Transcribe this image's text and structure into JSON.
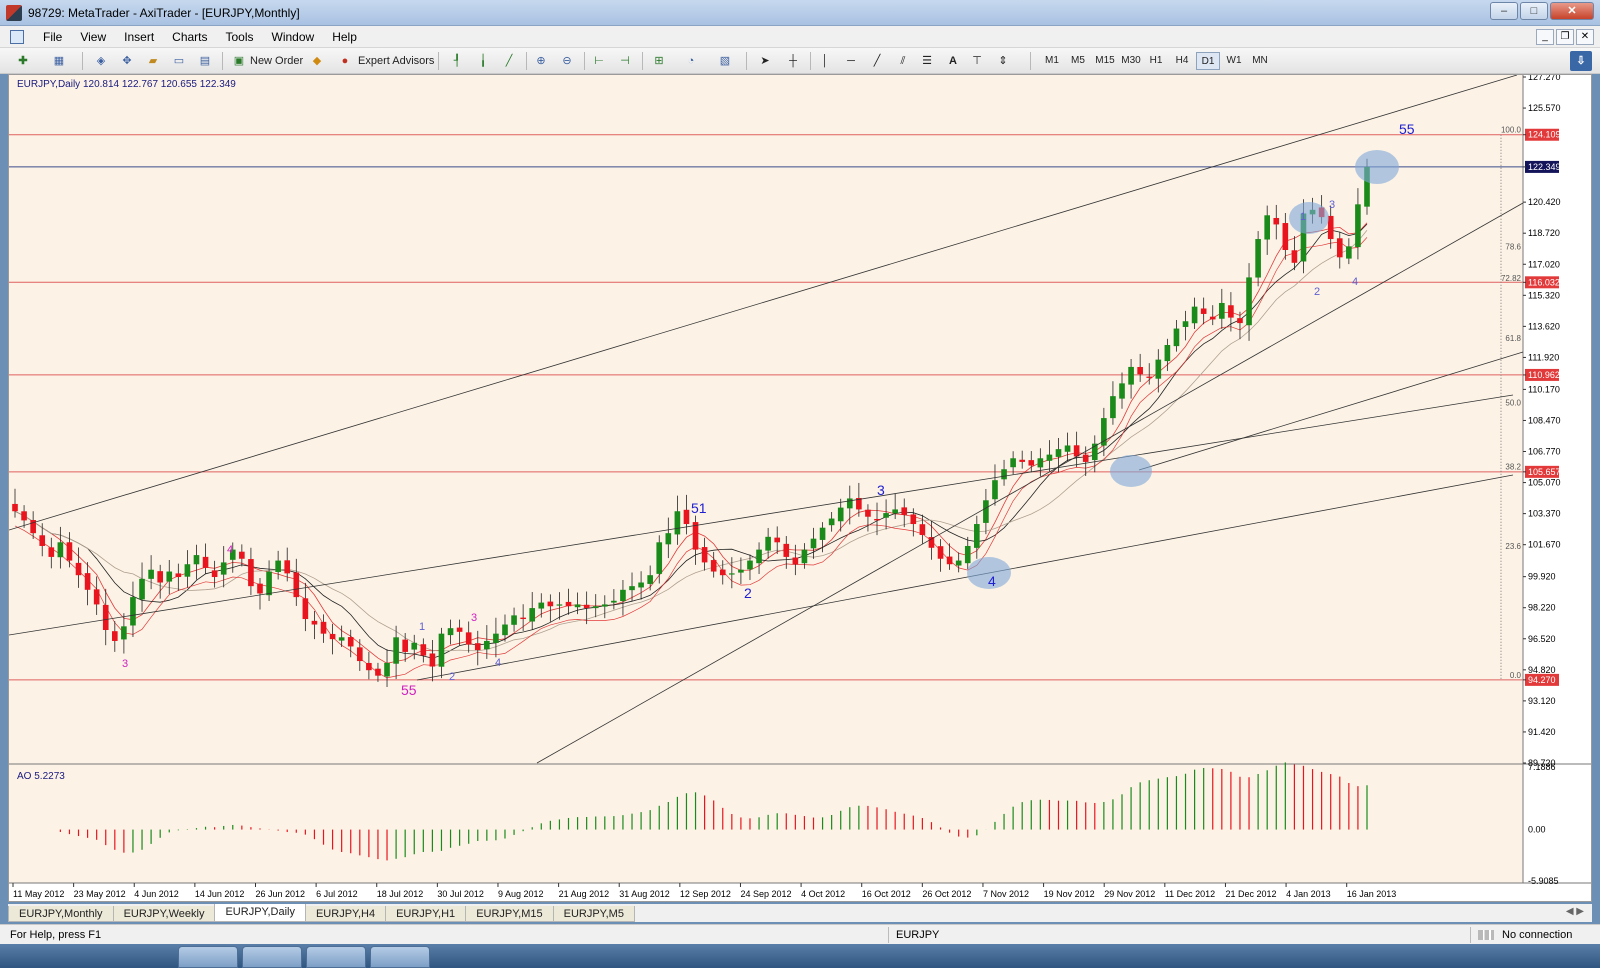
{
  "window": {
    "title": "98729: MetaTrader - AxiTrader - [EURJPY,Monthly]",
    "minimize": "–",
    "maximize": "□",
    "close": "✕"
  },
  "menu": [
    "File",
    "View",
    "Insert",
    "Charts",
    "Tools",
    "Window",
    "Help"
  ],
  "mdi": {
    "minimize": "_",
    "restore": "❐",
    "close": "✕"
  },
  "toolbar": {
    "new_order": "New Order",
    "expert_advisors": "Expert Advisors",
    "text_tool": "A",
    "timeframes": [
      "M1",
      "M5",
      "M15",
      "M30",
      "H1",
      "H4",
      "D1",
      "W1",
      "MN"
    ],
    "active_timeframe": "D1"
  },
  "chart": {
    "symbol_info": "EURJPY,Daily  120.814 122.767 120.655 122.349",
    "price_ticks": [
      "127.270",
      "125.570",
      "124.109",
      "122.349",
      "120.420",
      "118.720",
      "117.020",
      "116.032",
      "115.320",
      "113.620",
      "111.920",
      "110.962",
      "110.170",
      "108.470",
      "106.770",
      "105.657",
      "105.070",
      "103.370",
      "101.670",
      "99.920",
      "98.220",
      "96.520",
      "94.820",
      "94.270",
      "93.120",
      "91.420",
      "89.720"
    ],
    "highlighted_prices": {
      "current": "122.349",
      "red_levels": [
        "124.109",
        "116.032",
        "110.962",
        "105.657",
        "94.270"
      ]
    },
    "fib_labels": [
      "100.0",
      "78.6",
      "72.82",
      "61.8",
      "50.0",
      "38.2",
      "23.6",
      "0.0"
    ],
    "wave_labels": [
      "3",
      "4",
      "55",
      "1",
      "2",
      "3",
      "4",
      "51",
      "2",
      "3",
      "4",
      "1",
      "2",
      "3",
      "4",
      "55"
    ],
    "date_ticks": [
      "11 May 2012",
      "23 May 2012",
      "4 Jun 2012",
      "14 Jun 2012",
      "26 Jun 2012",
      "6 Jul 2012",
      "18 Jul 2012",
      "30 Jul 2012",
      "9 Aug 2012",
      "21 Aug 2012",
      "31 Aug 2012",
      "12 Sep 2012",
      "24 Sep 2012",
      "4 Oct 2012",
      "16 Oct 2012",
      "26 Oct 2012",
      "7 Nov 2012",
      "19 Nov 2012",
      "29 Nov 2012",
      "11 Dec 2012",
      "21 Dec 2012",
      "4 Jan 2013",
      "16 Jan 2013"
    ],
    "ao_label": "AO 5.2273",
    "ao_ticks": [
      "7.1886",
      "0.00",
      "-5.9085"
    ]
  },
  "chart_data": {
    "type": "line",
    "title": "",
    "price": {
      "open": 120.814,
      "high": 122.767,
      "low": 120.655,
      "close": 122.349
    },
    "ylim": [
      89.72,
      127.27
    ],
    "close_series": [
      103.5,
      103.0,
      102.3,
      101.6,
      101.0,
      101.8,
      100.8,
      100.0,
      99.2,
      98.4,
      97.0,
      96.4,
      97.2,
      98.8,
      99.8,
      100.3,
      99.6,
      100.2,
      99.9,
      100.6,
      101.1,
      100.4,
      99.9,
      100.7,
      101.4,
      100.9,
      99.4,
      99.0,
      100.2,
      100.8,
      100.1,
      98.8,
      97.6,
      97.3,
      96.8,
      96.5,
      96.6,
      96.1,
      95.3,
      94.8,
      94.5,
      95.2,
      96.6,
      95.8,
      96.3,
      95.6,
      95.0,
      96.8,
      97.1,
      96.9,
      96.2,
      95.9,
      96.4,
      96.8,
      97.3,
      97.8,
      97.6,
      98.2,
      98.5,
      98.3,
      98.4,
      98.3,
      98.4,
      98.2,
      98.3,
      98.4,
      98.6,
      99.2,
      99.4,
      99.6,
      100.0,
      101.8,
      102.3,
      103.5,
      102.8,
      101.4,
      100.7,
      100.2,
      100.0,
      100.1,
      100.3,
      100.8,
      101.4,
      102.1,
      101.8,
      101.0,
      100.6,
      101.4,
      102.0,
      102.6,
      103.1,
      103.7,
      104.2,
      103.6,
      103.2,
      103.0,
      103.4,
      103.6,
      103.3,
      102.8,
      102.2,
      101.5,
      100.9,
      100.6,
      100.8,
      101.6,
      102.8,
      104.1,
      105.2,
      105.8,
      106.4,
      106.2,
      106.0,
      106.4,
      106.6,
      106.9,
      107.1,
      106.5,
      106.2,
      107.2,
      108.6,
      109.8,
      110.5,
      111.4,
      111.0,
      110.8,
      111.8,
      112.6,
      113.5,
      113.9,
      114.7,
      114.3,
      114.0,
      114.9,
      114.1,
      113.8,
      116.3,
      118.4,
      119.7,
      119.2,
      117.8,
      117.1,
      119.8,
      120.0,
      119.6,
      118.4,
      117.4,
      118.0,
      120.3,
      122.349
    ],
    "x": [
      "11 May 2012",
      "23 May 2012",
      "4 Jun 2012",
      "14 Jun 2012",
      "26 Jun 2012",
      "6 Jul 2012",
      "18 Jul 2012",
      "30 Jul 2012",
      "9 Aug 2012",
      "21 Aug 2012",
      "31 Aug 2012",
      "12 Sep 2012",
      "24 Sep 2012",
      "4 Oct 2012",
      "16 Oct 2012",
      "26 Oct 2012",
      "7 Nov 2012",
      "19 Nov 2012",
      "29 Nov 2012",
      "11 Dec 2012",
      "21 Dec 2012",
      "4 Jan 2013",
      "16 Jan 2013"
    ],
    "horizontal_levels": [
      124.109,
      116.032,
      110.962,
      105.657,
      94.27
    ],
    "current_price": 122.349,
    "ao": {
      "max": 7.1886,
      "min": -5.9085,
      "last": 5.2273
    },
    "grid": false
  },
  "tabs": [
    "EURJPY,Monthly",
    "EURJPY,Weekly",
    "EURJPY,Daily",
    "EURJPY,H4",
    "EURJPY,H1",
    "EURJPY,M15",
    "EURJPY,M5"
  ],
  "active_tab": "EURJPY,Daily",
  "status": {
    "help": "For Help, press F1",
    "symbol": "EURJPY",
    "connection": "No connection"
  },
  "colors": {
    "bg": "#fcf3e6",
    "bull": "#1a8a1a",
    "bear": "#e8141e",
    "level": "#e06060",
    "wave_blue": "#2020d0",
    "wave_magenta": "#d020c0",
    "highlight": "#7fa8d8"
  }
}
